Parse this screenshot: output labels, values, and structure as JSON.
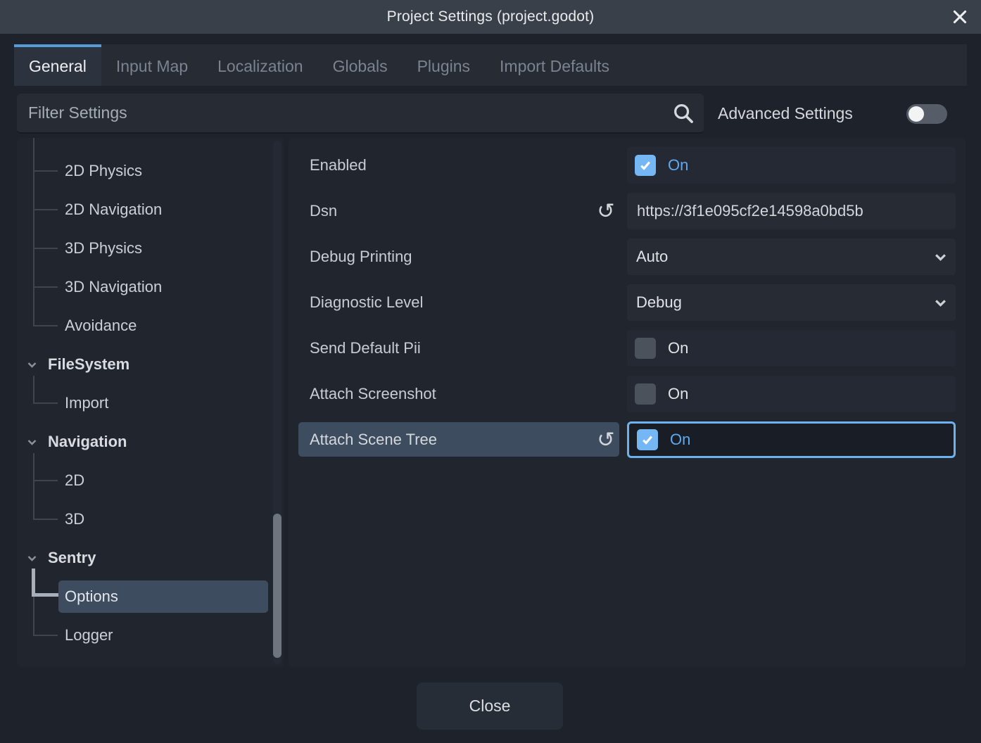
{
  "window": {
    "title": "Project Settings (project.godot)"
  },
  "tabs": [
    {
      "label": "General",
      "active": true
    },
    {
      "label": "Input Map",
      "active": false
    },
    {
      "label": "Localization",
      "active": false
    },
    {
      "label": "Globals",
      "active": false
    },
    {
      "label": "Plugins",
      "active": false
    },
    {
      "label": "Import Defaults",
      "active": false
    }
  ],
  "filter": {
    "placeholder": "Filter Settings",
    "search_icon": "magnifier",
    "advanced_label": "Advanced Settings",
    "advanced_toggle_on": false
  },
  "sidebar": {
    "items": [
      {
        "label": "2D Physics",
        "type": "child"
      },
      {
        "label": "2D Navigation",
        "type": "child"
      },
      {
        "label": "3D Physics",
        "type": "child"
      },
      {
        "label": "3D Navigation",
        "type": "child"
      },
      {
        "label": "Avoidance",
        "type": "child"
      },
      {
        "label": "FileSystem",
        "type": "category",
        "expanded": true
      },
      {
        "label": "Import",
        "type": "child"
      },
      {
        "label": "Navigation",
        "type": "category",
        "expanded": true
      },
      {
        "label": "2D",
        "type": "child"
      },
      {
        "label": "3D",
        "type": "child"
      },
      {
        "label": "Sentry",
        "type": "category",
        "expanded": true
      },
      {
        "label": "Options",
        "type": "child",
        "selected": true
      },
      {
        "label": "Logger",
        "type": "child"
      }
    ]
  },
  "settings": {
    "rows": [
      {
        "label": "Enabled",
        "type": "checkbox",
        "checked": true,
        "value": "On"
      },
      {
        "label": "Dsn",
        "type": "text",
        "value": "https://3f1e095cf2e14598a0bd5b",
        "revert": true
      },
      {
        "label": "Debug Printing",
        "type": "dropdown",
        "value": "Auto"
      },
      {
        "label": "Diagnostic Level",
        "type": "dropdown",
        "value": "Debug"
      },
      {
        "label": "Send Default Pii",
        "type": "checkbox",
        "checked": false,
        "value": "On"
      },
      {
        "label": "Attach Screenshot",
        "type": "checkbox",
        "checked": false,
        "value": "On"
      },
      {
        "label": "Attach Scene Tree",
        "type": "checkbox",
        "checked": true,
        "value": "On",
        "revert": true,
        "selected": true,
        "focused": true
      }
    ]
  },
  "footer": {
    "close_label": "Close"
  },
  "colors": {
    "titlebar": "#3a4049",
    "dialog_bg": "#1d222b",
    "panel_bg": "#20252e",
    "field_bg": "#262b34",
    "tab_accent": "#549bd8",
    "accent_blue": "#5fa9ef",
    "checkbox_blue": "#74b7f4",
    "selected_row": "#3d4c5f",
    "focus_border": "#6db1ef"
  }
}
